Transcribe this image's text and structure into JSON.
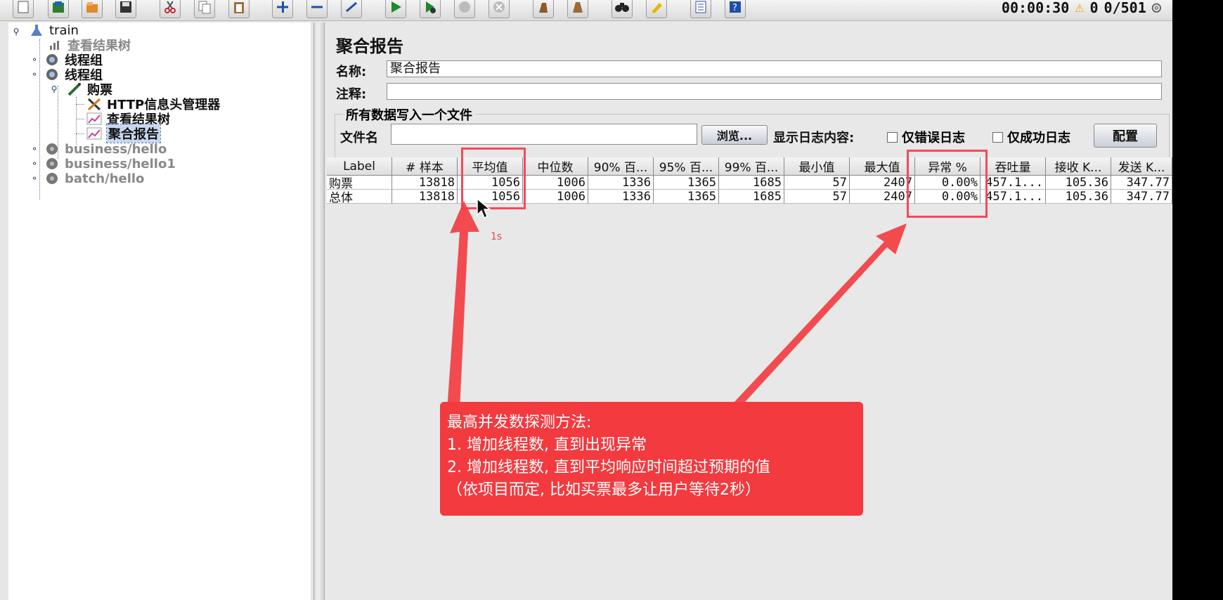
{
  "toolbar": {
    "timer": "00:00:30",
    "warning_count": "0",
    "threads": "0/501",
    "icons": [
      "new-icon",
      "templates-icon",
      "open-icon",
      "save-icon",
      "cut-icon",
      "copy-icon",
      "paste-icon",
      "expand-icon",
      "collapse-icon",
      "toggle-icon",
      "start-icon",
      "start-no-pause-icon",
      "stop-icon",
      "shutdown-icon",
      "clear-icon",
      "clear-all-icon",
      "search-icon",
      "reset-search-icon",
      "function-helper-icon",
      "help-icon"
    ]
  },
  "tree": {
    "root": "train",
    "items": [
      {
        "label": "查看结果树",
        "disabled": true
      },
      {
        "label": "线程组"
      },
      {
        "label": "线程组"
      },
      {
        "label": "购票"
      },
      {
        "label": "HTTP信息头管理器"
      },
      {
        "label": "查看结果树"
      },
      {
        "label": "聚合报告",
        "selected": true
      },
      {
        "label": "business/hello",
        "disabled": true
      },
      {
        "label": "business/hello1",
        "disabled": true
      },
      {
        "label": "batch/hello",
        "disabled": true
      }
    ]
  },
  "panel": {
    "title": "聚合报告",
    "name_label": "名称:",
    "name_value": "聚合报告",
    "comment_label": "注释:",
    "comment_value": "",
    "file_section_title": "所有数据写入一个文件",
    "filename_label": "文件名",
    "filename_value": "",
    "browse_button": "浏览...",
    "log_label": "显示日志内容:",
    "errors_only": "仅错误日志",
    "success_only": "仅成功日志",
    "config_button": "配置"
  },
  "table": {
    "headers": [
      "Label",
      "# 样本",
      "平均值",
      "中位数",
      "90% 百...",
      "95% 百...",
      "99% 百...",
      "最小值",
      "最大值",
      "异常 %",
      "吞吐量",
      "接收 K...",
      "发送 K..."
    ],
    "rows": [
      [
        "购票",
        "13818",
        "1056",
        "1006",
        "1336",
        "1365",
        "1685",
        "57",
        "2407",
        "0.00%",
        "457.1...",
        "105.36",
        "347.77"
      ],
      [
        "总体",
        "13818",
        "1056",
        "1006",
        "1336",
        "1365",
        "1685",
        "57",
        "2407",
        "0.00%",
        "457.1...",
        "105.36",
        "347.77"
      ]
    ]
  },
  "annotation": {
    "one_s": "1s",
    "lines": [
      "最高并发数探测方法:",
      "1. 增加线程数, 直到出现异常",
      "2. 增加线程数, 直到平均响应时间超过预期的值",
      "（依项目而定, 比如买票最多让用户等待2秒）"
    ],
    "highlight_color": "#f44a5a",
    "callout_color": "#f23a3f"
  }
}
